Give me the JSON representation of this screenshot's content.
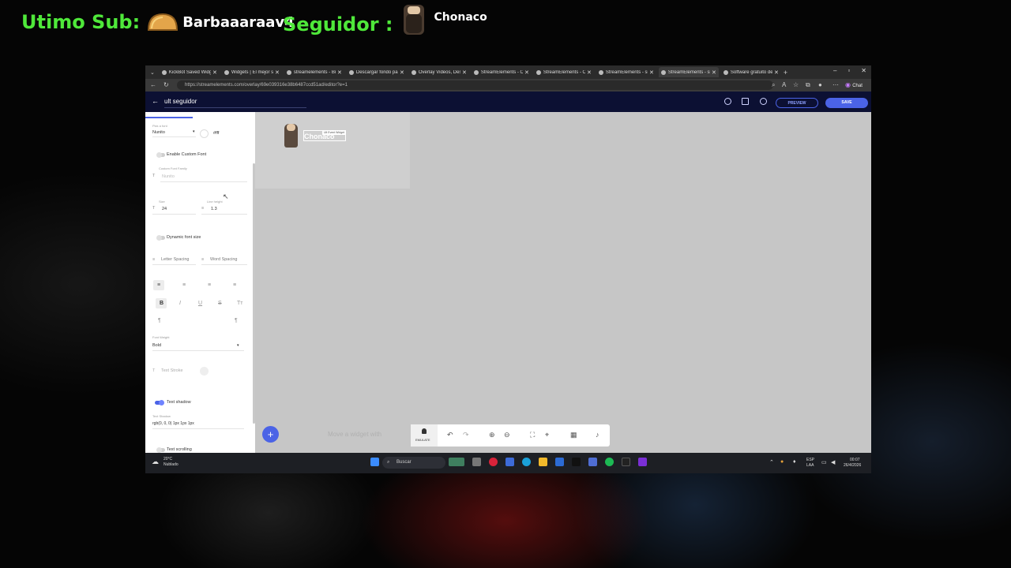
{
  "stream_overlay": {
    "last_sub_label": "Utimo Sub:",
    "last_sub_name": "Barbaaaraav4",
    "follower_label": "Seguidor :",
    "follower_name": "Chonaco"
  },
  "browser": {
    "tabs": [
      {
        "label": "KickBot Saved Widg"
      },
      {
        "label": "Widgets | El mejor s"
      },
      {
        "label": "streamelements - Bú"
      },
      {
        "label": "Descargar fondo par"
      },
      {
        "label": "Overlay Videos, Des"
      },
      {
        "label": "StreamElements - O"
      },
      {
        "label": "StreamElements - O"
      },
      {
        "label": "StreamElements - sli"
      },
      {
        "label": "StreamElements - sli"
      },
      {
        "label": "Software gratuito de"
      }
    ],
    "active_tab_index": 8,
    "url": "https://streamelements.com/overlay/69e039316e38b6487ccd51ad/editor?e=1",
    "chat_label": "Chat"
  },
  "editor": {
    "overlay_title": "ult seguidor",
    "preview_label": "PREVIEW",
    "save_label": "SAVE",
    "widget_text": "Chonaco",
    "widget_tag": "Ult Event Widget",
    "hint_text": "Move a widget with",
    "emulate_label": "EMULATE",
    "accent_color": "#4b63e6"
  },
  "panel": {
    "pick_font_label": "Pick a font",
    "font_value": "Nunito",
    "color_value": "#fff",
    "enable_custom_font": "Enable Custom Font",
    "custom_font_family_label": "Custom Font Family",
    "custom_font_placeholder": "Nunito",
    "size_label": "Size",
    "size_value": "24",
    "line_height_label": "Line height",
    "line_height_value": "1.3",
    "dynamic_font_size": "Dynamic font size",
    "letter_spacing": "Letter Spacing",
    "word_spacing": "Word Spacing",
    "font_weight_label": "Font Weight",
    "font_weight_value": "Bold",
    "text_stroke": "Text Stroke",
    "text_shadow": "Text shadow",
    "text_shadow_label": "Text Shadow",
    "text_shadow_value": "rgb(0, 0, 0) 1px 1px 1px",
    "text_scrolling": "Text scrolling",
    "text_shadow_on": true
  },
  "taskbar": {
    "weather_temp": "20°C",
    "weather_desc": "Nublado",
    "search_label": "Buscar",
    "lang_line1": "ESP",
    "lang_line2": "LAA",
    "time": "00:07",
    "date": "26/4/2026"
  }
}
